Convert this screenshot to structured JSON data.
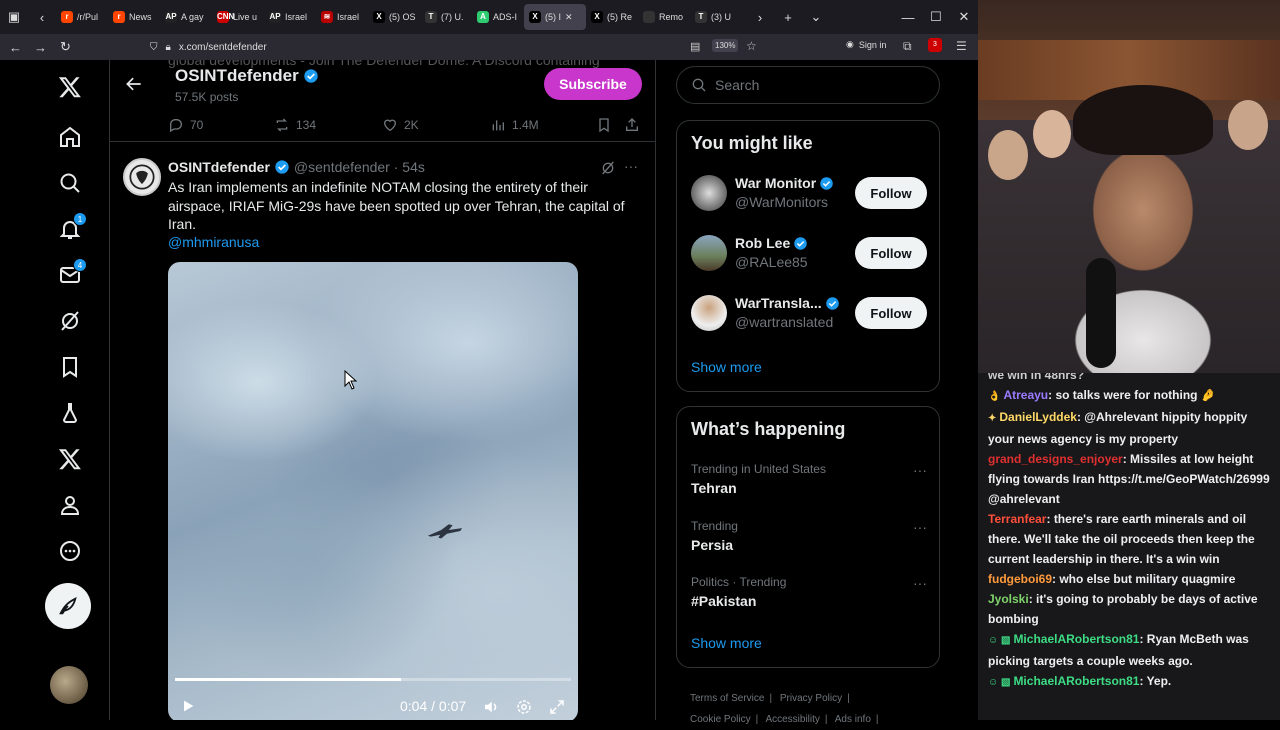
{
  "browser": {
    "tabs": [
      {
        "label": "/r/Pul",
        "color": "#ff4500",
        "glyph": "r"
      },
      {
        "label": "News",
        "color": "#ff4500",
        "glyph": "r"
      },
      {
        "label": "A gay",
        "color": "#222",
        "glyph": "AP"
      },
      {
        "label": "Live u",
        "color": "#cc0000",
        "glyph": "CNN"
      },
      {
        "label": "Israel",
        "color": "#222",
        "glyph": "AP"
      },
      {
        "label": "Israel",
        "color": "#b00",
        "glyph": "≋"
      },
      {
        "label": "(5) OS",
        "color": "#000",
        "glyph": "X"
      },
      {
        "label": "(7) U.",
        "color": "#333",
        "glyph": "T"
      },
      {
        "label": "ADS-I",
        "color": "#2ecc71",
        "glyph": "A"
      },
      {
        "label": "(5) I",
        "color": "#000",
        "glyph": "X",
        "active": true
      },
      {
        "label": "(5) Re",
        "color": "#000",
        "glyph": "X"
      },
      {
        "label": "Remo",
        "color": "#333",
        "glyph": ""
      },
      {
        "label": "(3) U",
        "color": "#333",
        "glyph": "T"
      }
    ],
    "url": "x.com/sentdefender",
    "zoom": "130%",
    "signin": "Sign in",
    "ext_badge": "3"
  },
  "header": {
    "bg_text": "global developments - Join The Defender Dome: A Discord containing",
    "name": "OSINTdefender",
    "posts": "57.5K posts",
    "subscribe": "Subscribe"
  },
  "actions": {
    "replies": "70",
    "reposts": "134",
    "likes": "2K",
    "views": "1.4M"
  },
  "tweet": {
    "name": "OSINTdefender",
    "handle": "@sentdefender · 54s",
    "text": "As Iran implements an indefinite NOTAM closing the entirety of their airspace, IRIAF MiG-29s have been spotted up over Tehran, the capital of Iran.",
    "mention": "@mhmiranusa",
    "video_time": "0:04 / 0:07",
    "progress": 0.57
  },
  "nav": {
    "notif_count": "1",
    "msg_count": "4"
  },
  "sidebar": {
    "search_placeholder": "Search",
    "wtf_title": "You might like",
    "wtf": [
      {
        "name": "War Monitor",
        "handle": "@WarMonitors",
        "follow": "Follow"
      },
      {
        "name": "Rob Lee",
        "handle": "@RALee85",
        "follow": "Follow"
      },
      {
        "name": "WarTransla...",
        "handle": "@wartranslated",
        "follow": "Follow"
      }
    ],
    "show_more": "Show more",
    "happening_title": "What’s happening",
    "trends": [
      {
        "context": "Trending in United States",
        "topic": "Tehran"
      },
      {
        "context": "Trending",
        "topic": "Persia"
      },
      {
        "context": "Politics · Trending",
        "topic": "#Pakistan"
      }
    ],
    "show_more2": "Show more",
    "footer": {
      "terms": "Terms of Service",
      "privacy": "Privacy Policy",
      "cookie": "Cookie Policy",
      "access": "Accessibility",
      "ads": "Ads info"
    }
  },
  "chat": {
    "partial_top": "we win in 48hrs?",
    "messages": [
      {
        "user": "Atreayu",
        "color": "#9b7bff",
        "text": ": so talks were for nothing 🤌",
        "icon": "👌"
      },
      {
        "user": "DanielLyddek",
        "color": "#ffd966",
        "text": ": @Ahrelevant hippity hoppity your news agency is my property",
        "icon": "✦"
      },
      {
        "user": "grand_designs_enjoyer",
        "color": "#e03030",
        "text": ": Missiles at low height flying towards Iran https://t.me/GeoPWatch/26999 @ahrelevant",
        "icon": ""
      },
      {
        "user": "Terranfear",
        "color": "#ff4f3a",
        "text": ": there's rare earth minerals and oil there. We'll take the oil proceeds then keep the current leadership in there. It's a win win",
        "icon": ""
      },
      {
        "user": "fudgeboi69",
        "color": "#ff9a3c",
        "text": ": who else but military quagmire",
        "icon": ""
      },
      {
        "user": "Jyolski",
        "color": "#7fd36a",
        "text": ": it's going to probably be days of active bombing",
        "icon": ""
      },
      {
        "user": "MichaelARobertson81",
        "color": "#3ddc84",
        "text": ": Ryan McBeth was picking targets a couple weeks ago.",
        "icon": "☺ ▧"
      },
      {
        "user": "MichaelARobertson81",
        "color": "#3ddc84",
        "text": ": Yep.",
        "icon": "☺ ▧"
      }
    ]
  },
  "colors": {
    "accent": "#1d9bf0",
    "subscribe": "#c936cc",
    "bg": "#000000",
    "chat_bg": "#18181b"
  }
}
